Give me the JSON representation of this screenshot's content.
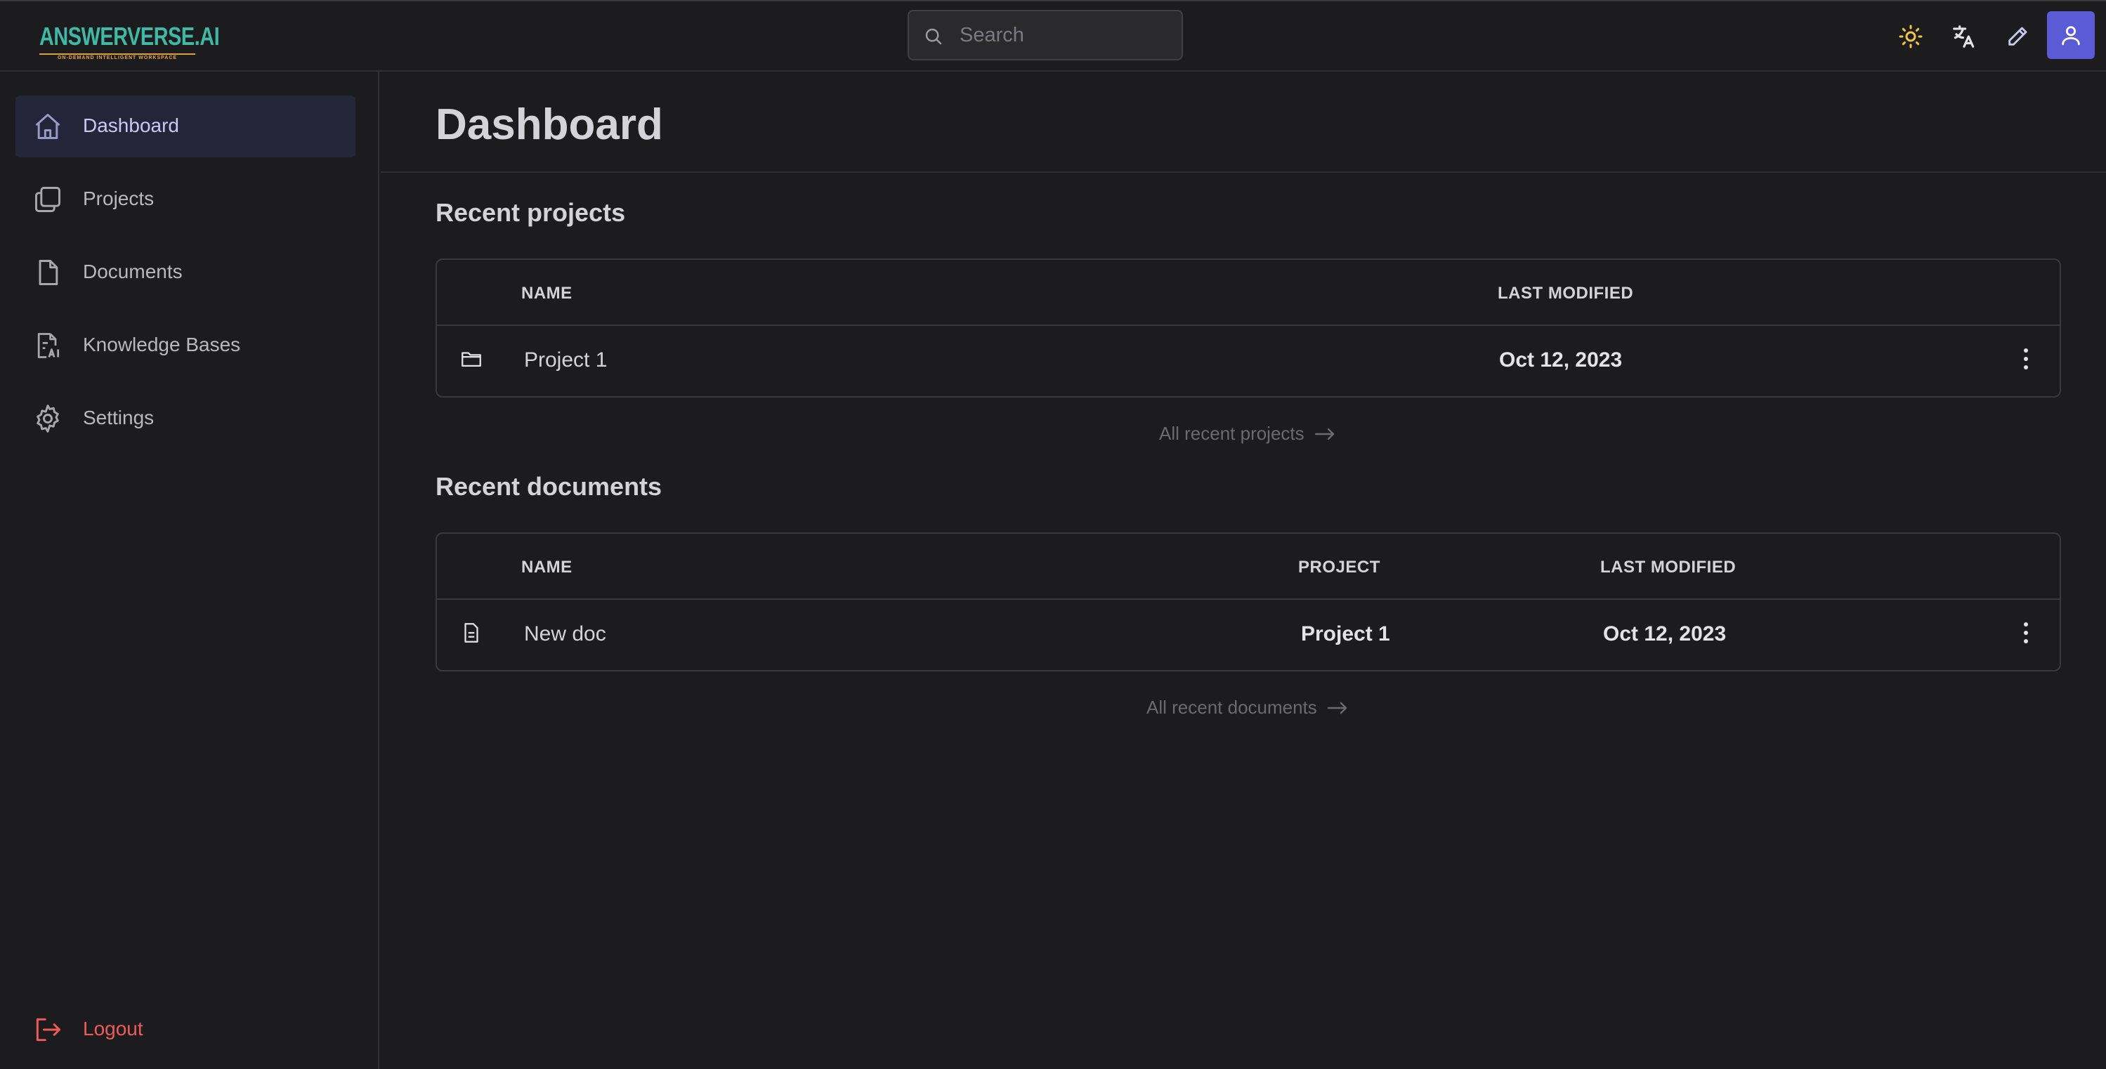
{
  "app": {
    "logo_text": "ANSWERVERSE.AI",
    "logo_tagline": "ON-DEMAND INTELLIGENT WORKSPACE"
  },
  "search": {
    "placeholder": "Search"
  },
  "sidebar": {
    "items": [
      {
        "label": "Dashboard",
        "icon": "home-icon",
        "active": true
      },
      {
        "label": "Projects",
        "icon": "projects-icon",
        "active": false
      },
      {
        "label": "Documents",
        "icon": "document-icon",
        "active": false
      },
      {
        "label": "Knowledge Bases",
        "icon": "knowledge-base-icon",
        "active": false
      },
      {
        "label": "Settings",
        "icon": "gear-icon",
        "active": false
      }
    ],
    "logout_label": "Logout"
  },
  "main": {
    "title": "Dashboard",
    "recent_projects": {
      "title": "Recent projects",
      "columns": [
        "NAME",
        "LAST MODIFIED"
      ],
      "rows": [
        {
          "name": "Project 1",
          "last_modified": "Oct 12, 2023"
        }
      ],
      "all_link": "All recent projects"
    },
    "recent_documents": {
      "title": "Recent documents",
      "columns": [
        "NAME",
        "PROJECT",
        "LAST MODIFIED"
      ],
      "rows": [
        {
          "name": "New doc",
          "project": "Project 1",
          "last_modified": "Oct 12, 2023"
        }
      ],
      "all_link": "All recent documents"
    }
  },
  "colors": {
    "background": "#1c1c1e",
    "accent": "#5b5bd6",
    "logo": "#3fb8a6",
    "logout": "#ef5a5a",
    "sun": "#f5c542"
  }
}
